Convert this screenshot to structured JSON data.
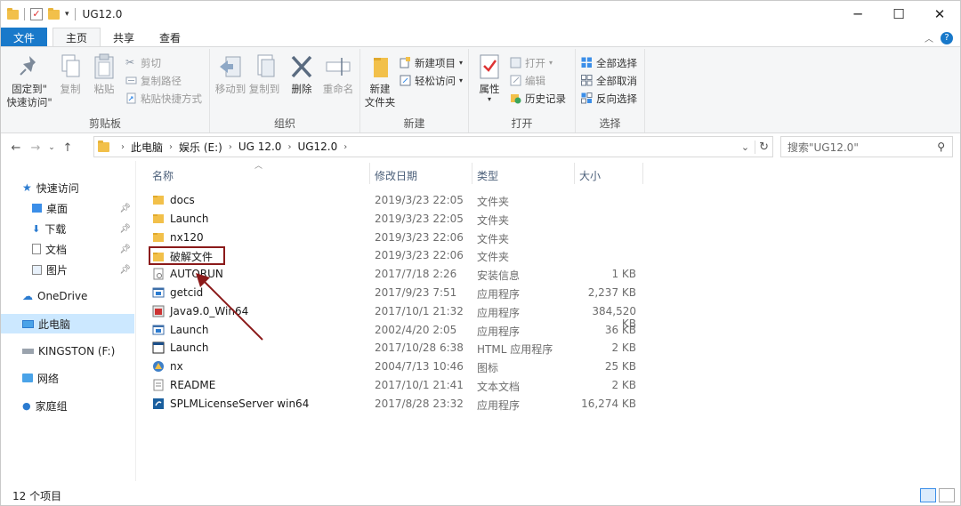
{
  "window": {
    "title": "UG12.0",
    "controls": [
      "minimize-icon",
      "maximize-icon",
      "close-icon"
    ]
  },
  "ribbon_tabs": [
    {
      "label": "文件"
    },
    {
      "label": "主页"
    },
    {
      "label": "共享"
    },
    {
      "label": "查看"
    }
  ],
  "ribbon": {
    "clipboard": {
      "group": "剪贴板",
      "pin_l1": "固定到\"",
      "pin_l2": "快速访问\"",
      "copy": "复制",
      "paste": "粘贴",
      "cut": "剪切",
      "copy_path": "复制路径",
      "paste_shortcut": "粘贴快捷方式"
    },
    "organize": {
      "group": "组织",
      "move_to": "移动到",
      "copy_to": "复制到",
      "delete": "删除",
      "rename": "重命名"
    },
    "new": {
      "group": "新建",
      "new_folder_l1": "新建",
      "new_folder_l2": "文件夹",
      "new_item": "新建项目",
      "easy_access": "轻松访问"
    },
    "open": {
      "group": "打开",
      "properties": "属性",
      "open": "打开",
      "edit": "编辑",
      "history": "历史记录"
    },
    "select": {
      "group": "选择",
      "select_all": "全部选择",
      "select_none": "全部取消",
      "invert": "反向选择"
    }
  },
  "address": {
    "crumbs": [
      "此电脑",
      "娱乐 (E:)",
      "UG 12.0",
      "UG12.0"
    ]
  },
  "search": {
    "placeholder": "搜索\"UG12.0\""
  },
  "nav": {
    "quick_access": "快速访问",
    "desktop": "桌面",
    "downloads": "下载",
    "documents": "文档",
    "pictures": "图片",
    "onedrive": "OneDrive",
    "this_pc": "此电脑",
    "kingston": "KINGSTON (F:)",
    "network": "网络",
    "homegroup": "家庭组"
  },
  "columns": {
    "name": "名称",
    "date": "修改日期",
    "type": "类型",
    "size": "大小"
  },
  "files": [
    {
      "name": "docs",
      "date": "2019/3/23 22:05",
      "type": "文件夹",
      "size": "",
      "icon": "folder-icon"
    },
    {
      "name": "Launch",
      "date": "2019/3/23 22:05",
      "type": "文件夹",
      "size": "",
      "icon": "folder-icon"
    },
    {
      "name": "nx120",
      "date": "2019/3/23 22:06",
      "type": "文件夹",
      "size": "",
      "icon": "folder-icon"
    },
    {
      "name": "破解文件",
      "date": "2019/3/23 22:06",
      "type": "文件夹",
      "size": "",
      "icon": "folder-icon"
    },
    {
      "name": "AUTORUN",
      "date": "2017/7/18 2:26",
      "type": "安装信息",
      "size": "1 KB",
      "icon": "setup-info-icon"
    },
    {
      "name": "getcid",
      "date": "2017/9/23 7:51",
      "type": "应用程序",
      "size": "2,237 KB",
      "icon": "app-icon"
    },
    {
      "name": "Java9.0_Win64",
      "date": "2017/10/1 21:32",
      "type": "应用程序",
      "size": "384,520 KB",
      "icon": "java-installer-icon"
    },
    {
      "name": "Launch",
      "date": "2002/4/20 2:05",
      "type": "应用程序",
      "size": "36 KB",
      "icon": "app-icon"
    },
    {
      "name": "Launch",
      "date": "2017/10/28 6:38",
      "type": "HTML 应用程序",
      "size": "2 KB",
      "icon": "hta-icon"
    },
    {
      "name": "nx",
      "date": "2004/7/13 10:46",
      "type": "图标",
      "size": "25 KB",
      "icon": "nx-icon"
    },
    {
      "name": "README",
      "date": "2017/10/1 21:41",
      "type": "文本文档",
      "size": "2 KB",
      "icon": "text-doc-icon"
    },
    {
      "name": "SPLMLicenseServer win64",
      "date": "2017/8/28 23:32",
      "type": "应用程序",
      "size": "16,274 KB",
      "icon": "license-server-icon"
    }
  ],
  "status": {
    "count": "12 个项目"
  },
  "colors": {
    "accent": "#1979ca",
    "selected_nav": "#cce8ff",
    "annotation": "#8b1a1a",
    "folder": "#f2c04a"
  }
}
